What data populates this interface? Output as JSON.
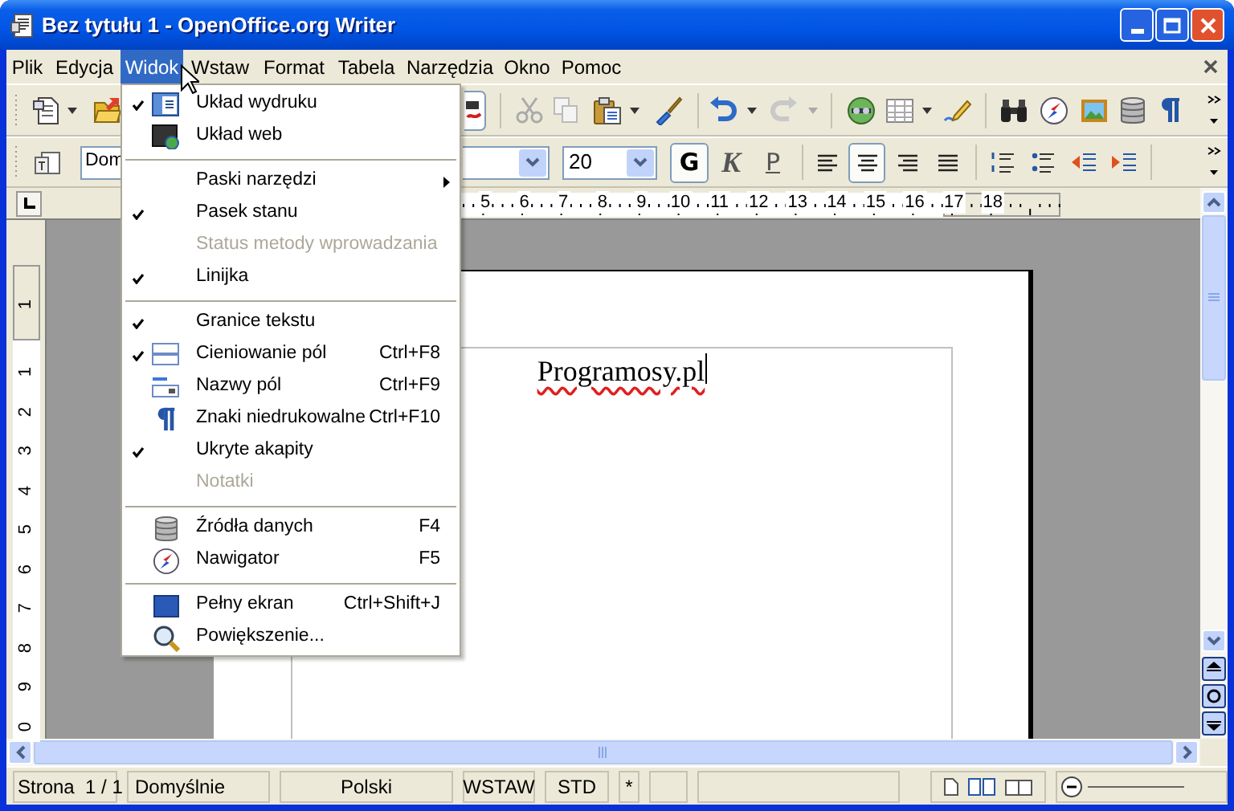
{
  "window": {
    "title": "Bez tytułu 1 - OpenOffice.org Writer"
  },
  "menubar": [
    {
      "label": "Plik",
      "selected": false
    },
    {
      "label": "Edycja",
      "selected": false
    },
    {
      "label": "Widok",
      "selected": true
    },
    {
      "label": "Wstaw",
      "selected": false
    },
    {
      "label": "Format",
      "selected": false
    },
    {
      "label": "Tabela",
      "selected": false
    },
    {
      "label": "Narzędzia",
      "selected": false
    },
    {
      "label": "Okno",
      "selected": false
    },
    {
      "label": "Pomoc",
      "selected": false
    }
  ],
  "view_menu": {
    "items": [
      {
        "kind": "item",
        "label": "Układ wydruku",
        "checked": true,
        "disabled": false,
        "submenu": false
      },
      {
        "kind": "item",
        "label": "Układ web",
        "checked": false,
        "disabled": false,
        "submenu": false
      },
      {
        "kind": "separator"
      },
      {
        "kind": "item",
        "label": "Paski narzędzi",
        "checked": false,
        "disabled": false,
        "submenu": true
      },
      {
        "kind": "item",
        "label": "Pasek stanu",
        "checked": true,
        "disabled": false,
        "submenu": false
      },
      {
        "kind": "item",
        "label": "Status metody wprowadzania",
        "checked": false,
        "disabled": true,
        "submenu": false
      },
      {
        "kind": "item",
        "label": "Linijka",
        "checked": true,
        "disabled": false,
        "submenu": false
      },
      {
        "kind": "separator"
      },
      {
        "kind": "item",
        "label": "Granice tekstu",
        "checked": true,
        "disabled": false,
        "submenu": false
      },
      {
        "kind": "item",
        "label": "Cieniowanie pól",
        "shortcut": "Ctrl+F8",
        "checked": true,
        "disabled": false,
        "submenu": false
      },
      {
        "kind": "item",
        "label": "Nazwy pól",
        "shortcut": "Ctrl+F9",
        "checked": false,
        "disabled": false,
        "submenu": false
      },
      {
        "kind": "item",
        "label": "Znaki niedrukowalne",
        "shortcut": "Ctrl+F10",
        "checked": false,
        "disabled": false,
        "submenu": false
      },
      {
        "kind": "item",
        "label": "Ukryte akapity",
        "checked": true,
        "disabled": false,
        "submenu": false
      },
      {
        "kind": "item",
        "label": "Notatki",
        "checked": false,
        "disabled": true,
        "submenu": false
      },
      {
        "kind": "separator"
      },
      {
        "kind": "item",
        "label": "Źródła danych",
        "shortcut": "F4",
        "checked": false,
        "disabled": false,
        "submenu": false
      },
      {
        "kind": "item",
        "label": "Nawigator",
        "shortcut": "F5",
        "checked": false,
        "disabled": false,
        "submenu": false
      },
      {
        "kind": "separator"
      },
      {
        "kind": "item",
        "label": "Pełny ekran",
        "shortcut": "Ctrl+Shift+J",
        "checked": false,
        "disabled": false,
        "submenu": false
      },
      {
        "kind": "item",
        "label": "Powiększenie...",
        "checked": false,
        "disabled": false,
        "submenu": false
      }
    ]
  },
  "formatting_toolbar": {
    "paragraph_style": "Dom",
    "font_size": "20",
    "text_style_buttons": [
      {
        "label": "G",
        "selected": true
      },
      {
        "label": "K",
        "selected": false
      },
      {
        "label": "P",
        "selected": false
      }
    ],
    "alignment_buttons": [
      {
        "selected": false
      },
      {
        "selected": true
      },
      {
        "selected": false
      },
      {
        "selected": false
      }
    ]
  },
  "horizontal_ruler": {
    "labels": [
      "5",
      "6",
      "7",
      "8",
      "9",
      "10",
      "11",
      "12",
      "13",
      "14",
      "15",
      "16",
      "17",
      "18"
    ]
  },
  "vertical_ruler": {
    "labels": [
      "1",
      "1",
      "2",
      "3",
      "4",
      "5",
      "6",
      "7",
      "8",
      "9",
      "0"
    ]
  },
  "document": {
    "text": "Programosy.pl"
  },
  "status_bar": [
    "Strona  1 / 1",
    "Domyślnie",
    "Polski",
    "WSTAW",
    "STD",
    "*"
  ]
}
